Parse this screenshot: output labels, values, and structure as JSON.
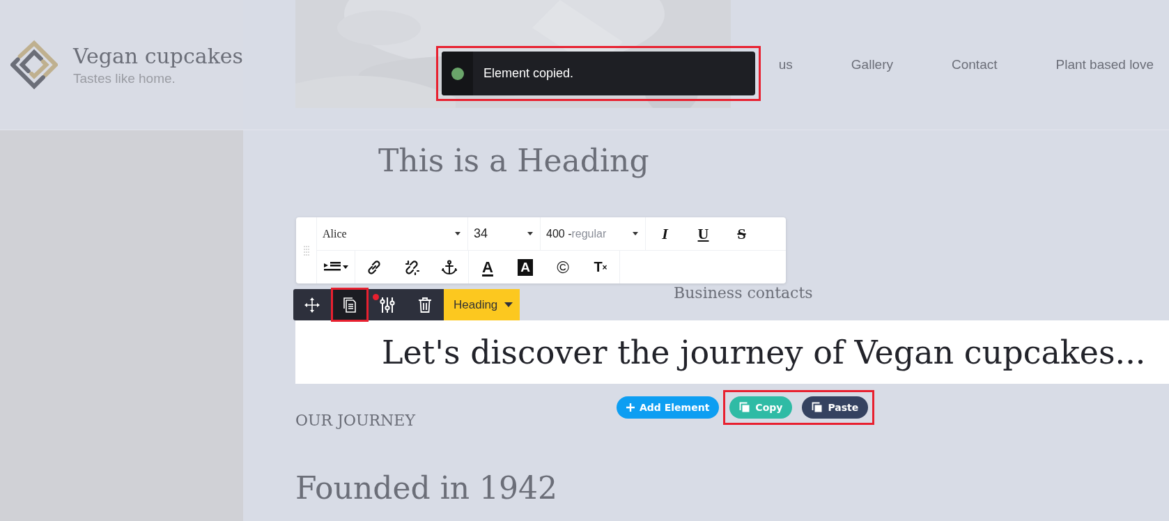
{
  "header": {
    "title": "Vegan cupcakes",
    "tagline": "Tastes like home.",
    "nav": [
      {
        "label": "us"
      },
      {
        "label": "Gallery"
      },
      {
        "label": "Contact"
      },
      {
        "label": "Plant based love"
      }
    ]
  },
  "toast": {
    "message": "Element copied.",
    "highlighted": true
  },
  "content": {
    "heading": "This is a Heading",
    "contacts": "Business contacts",
    "banner": "Let's discover the journey of Vegan cupcakes...",
    "eyebrow": "OUR JOURNEY",
    "subheading": "Founded in 1942"
  },
  "text_toolbar": {
    "font": "Alice",
    "size": "34",
    "weight": "400 -",
    "weight_name": "regular",
    "styles": [
      {
        "kind": "italic",
        "label": "I"
      },
      {
        "kind": "underline",
        "label": "U"
      },
      {
        "kind": "strike",
        "label": "S"
      }
    ],
    "tools": [
      {
        "kind": "indent"
      },
      {
        "kind": "link"
      },
      {
        "kind": "unlink"
      },
      {
        "kind": "anchor"
      },
      {
        "kind": "text-color",
        "label": "A"
      },
      {
        "kind": "highlight",
        "label": "A"
      },
      {
        "kind": "symbol",
        "label": "©"
      },
      {
        "kind": "clear-format",
        "label": "T",
        "mark": "×"
      }
    ]
  },
  "element_toolbar": {
    "type": "Heading",
    "tools": [
      {
        "kind": "move",
        "highlighted": false,
        "badge": false
      },
      {
        "kind": "copy",
        "highlighted": true,
        "badge": false
      },
      {
        "kind": "settings",
        "highlighted": false,
        "badge": true
      },
      {
        "kind": "delete",
        "highlighted": false,
        "badge": false
      }
    ]
  },
  "add_button": "Add Element",
  "clipboard": {
    "highlighted": true,
    "buttons": [
      {
        "kind": "copy",
        "label": "Copy"
      },
      {
        "kind": "paste",
        "label": "Paste"
      }
    ]
  }
}
